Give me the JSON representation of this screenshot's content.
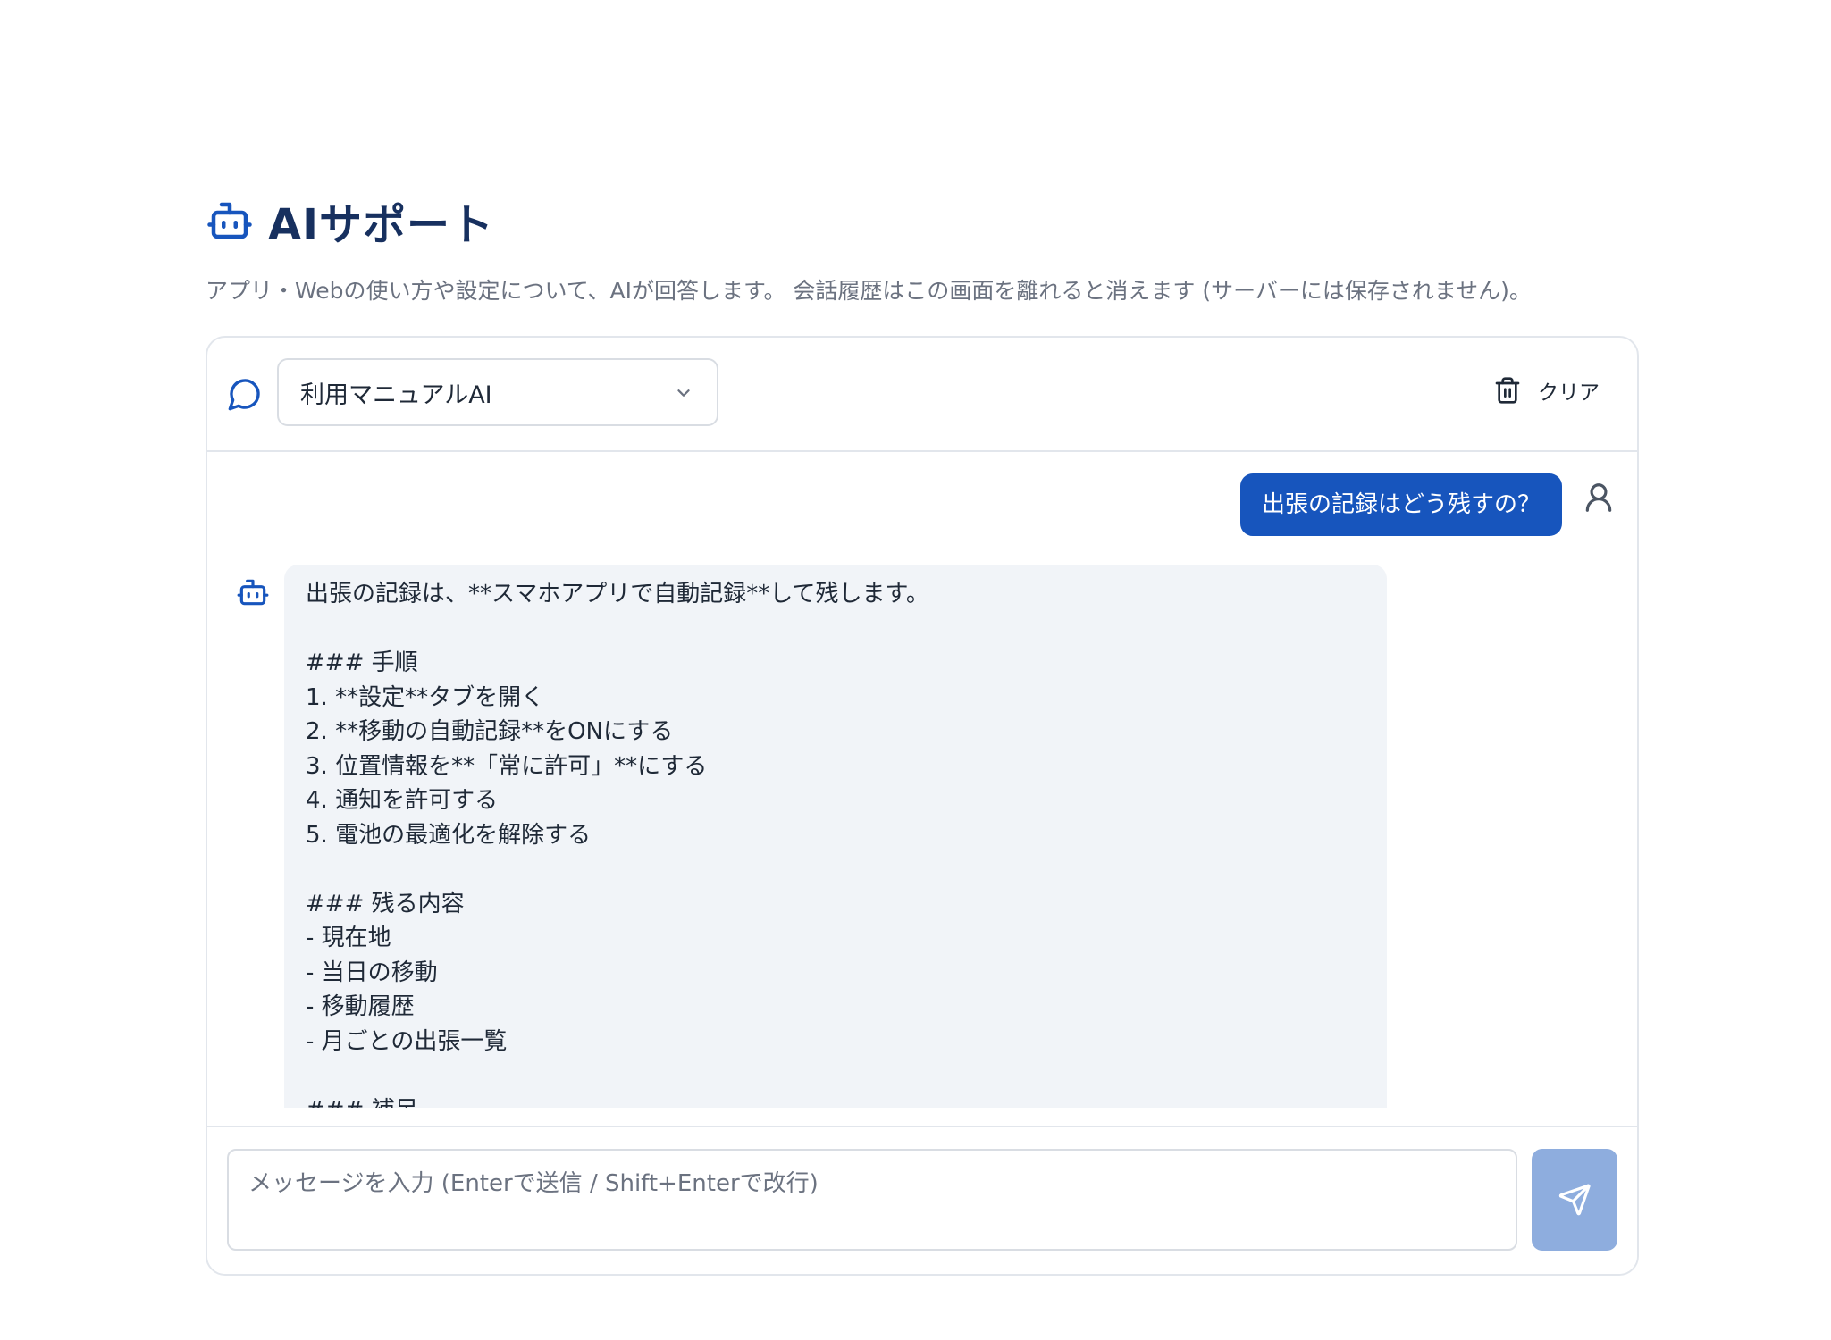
{
  "header": {
    "title": "AIサポート",
    "subtitle": "アプリ・Webの使い方や設定について、AIが回答します。 会話履歴はこの画面を離れると消えます (サーバーには保存されません)。",
    "icon": "robot-icon"
  },
  "toolbar": {
    "chat_icon": "chat-bubble-icon",
    "model_select_value": "利用マニュアルAI",
    "clear_label": "クリア",
    "clear_icon": "trash-icon"
  },
  "messages": [
    {
      "role": "user",
      "text": "出張の記録はどう残すの？"
    },
    {
      "role": "assistant",
      "text": "出張の記録は、**スマホアプリで自動記録**して残します。\n\n### 手順\n1. **設定**タブを開く\n2. **移動の自動記録**をONにする\n3. 位置情報を**「常に許可」**にする\n4. 通知を許可する\n5. 電池の最適化を解除する\n\n### 残る内容\n- 現在地\n- 当日の移動\n- 移動履歴\n- 月ごとの出張一覧\n\n### 補足"
    }
  ],
  "composer": {
    "placeholder": "メッセージを入力 (Enterで送信 / Shift+Enterで改行)",
    "value": "",
    "send_icon": "send-icon"
  },
  "colors": {
    "title": "#17305f",
    "accent": "#1755bd",
    "send_disabled": "#8eadde",
    "bot_bubble": "#f1f4f8"
  }
}
